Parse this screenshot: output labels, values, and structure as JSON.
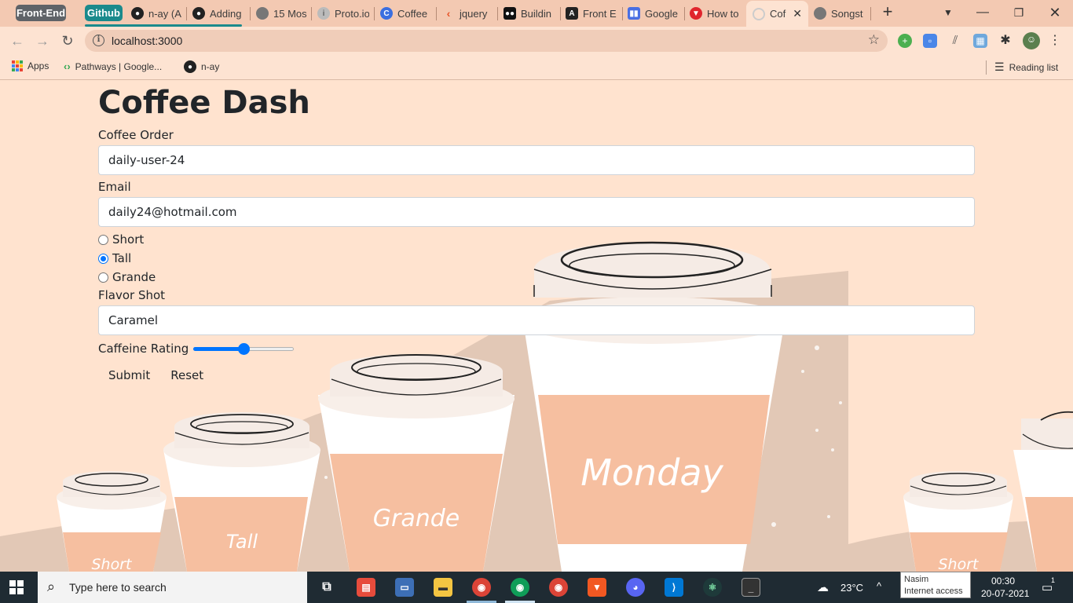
{
  "browser": {
    "tab_groups": [
      {
        "label": "Front-End",
        "color": "#5f6368"
      },
      {
        "label": "Github",
        "color": "#1a8a8c"
      }
    ],
    "tabs": [
      {
        "title": "n-ay (A",
        "icon": "github-icon"
      },
      {
        "title": "Adding",
        "icon": "github-icon"
      },
      {
        "title": "15 Mos",
        "icon": "globe-icon"
      },
      {
        "title": "Proto.io",
        "icon": "proto-icon"
      },
      {
        "title": "Coffee",
        "icon": "coffee-icon"
      },
      {
        "title": "jquery",
        "icon": "code-icon"
      },
      {
        "title": "Buildin",
        "icon": "medium-icon"
      },
      {
        "title": "Front E",
        "icon": "angular-icon"
      },
      {
        "title": "Google",
        "icon": "google-icon"
      },
      {
        "title": "How to",
        "icon": "vivaldi-icon"
      },
      {
        "title": "Cof",
        "icon": "loading-icon",
        "active": true
      },
      {
        "title": "Songst",
        "icon": "globe-icon"
      }
    ],
    "url": "localhost:3000",
    "bookmarks": [
      {
        "label": "Apps",
        "icon": "apps-grid-icon"
      },
      {
        "label": "Pathways | Google...",
        "icon": "pathways-icon"
      },
      {
        "label": "n-ay",
        "icon": "github-icon"
      }
    ],
    "reading_list": "Reading list"
  },
  "app": {
    "title": "Coffee Dash",
    "coffee_order_label": "Coffee Order",
    "coffee_order_value": "daily-user-24",
    "email_label": "Email",
    "email_value": "daily24@hotmail.com",
    "sizes": [
      {
        "label": "Short",
        "checked": false
      },
      {
        "label": "Tall",
        "checked": true
      },
      {
        "label": "Grande",
        "checked": false
      }
    ],
    "flavor_label": "Flavor Shot",
    "flavor_value": "Caramel",
    "caffeine_label": "Caffeine Rating",
    "caffeine_value": 0.5,
    "submit_label": "Submit",
    "reset_label": "Reset",
    "art_cup_labels": [
      "Short",
      "Tall",
      "Grande",
      "Monday",
      "Short"
    ]
  },
  "taskbar": {
    "search_placeholder": "Type here to search",
    "weather": "23°C",
    "tooltip_name": "Nasim",
    "tooltip_status": "Internet access",
    "time": "00:30",
    "date": "20-07-2021",
    "notification_count": "1"
  },
  "colors": {
    "page_bg": "#ffe3cf",
    "cup_sleeve": "#f6bfa0",
    "accent_blue": "#0075ff",
    "taskbar": "#1f2b33"
  }
}
